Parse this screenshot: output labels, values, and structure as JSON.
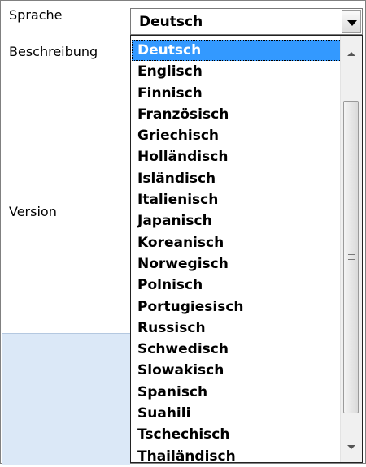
{
  "labels": {
    "sprache": "Sprache",
    "beschreibung": "Beschreibung",
    "version": "Version"
  },
  "combo": {
    "value": "Deutsch"
  },
  "dropdown": {
    "options": [
      "Deutsch",
      "Englisch",
      "Finnisch",
      "Französisch",
      "Griechisch",
      "Holländisch",
      "Isländisch",
      "Italienisch",
      "Japanisch",
      "Koreanisch",
      "Norwegisch",
      "Polnisch",
      "Portugiesisch",
      "Russisch",
      "Schwedisch",
      "Slowakisch",
      "Spanisch",
      "Suahili",
      "Tschechisch",
      "Thailändisch"
    ],
    "selected": "Deutsch"
  },
  "colors": {
    "selection": "#3399ff",
    "panel_fill": "#dbe8f7"
  },
  "icons": {
    "combo_button": "chevron-down-icon",
    "scroll_up": "scroll-up-arrow-icon",
    "scroll_down": "scroll-down-arrow-icon",
    "thumb_grip": "grip-icon"
  }
}
